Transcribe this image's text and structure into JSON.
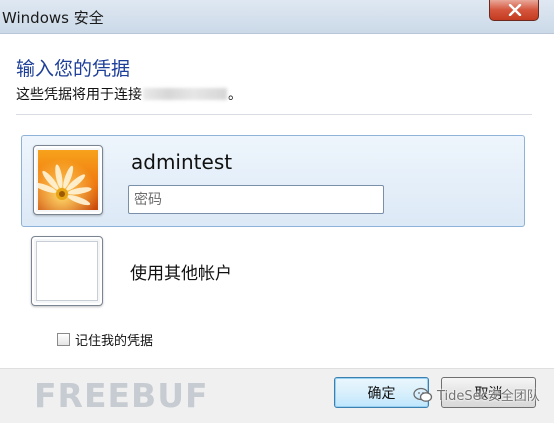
{
  "window": {
    "title": "Windows 安全"
  },
  "header": {
    "heading": "输入您的凭据",
    "subtext_prefix": "这些凭据将用于连接",
    "subtext_suffix": "。"
  },
  "credentials": {
    "selected": {
      "username": "admintest",
      "password_placeholder": "密码",
      "password_value": ""
    },
    "other_account_label": "使用其他帐户"
  },
  "options": {
    "remember_label": "记住我的凭据",
    "remember_checked": false
  },
  "buttons": {
    "ok_label": "确定",
    "cancel_label": "取消"
  },
  "watermarks": {
    "freebuf": "FREEBUF",
    "wechat": "TideSec安全团队"
  },
  "colors": {
    "heading": "#1e3f99",
    "selection": "#dce9f6",
    "close_button": "#c43b20"
  },
  "icons": {
    "close": "close-icon",
    "avatar": "flower-avatar-icon",
    "wechat": "wechat-icon"
  }
}
